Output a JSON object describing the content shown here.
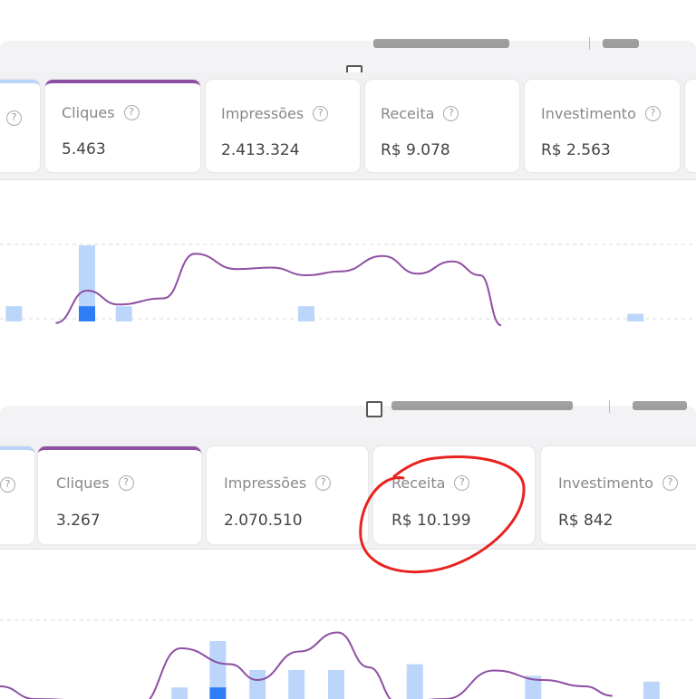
{
  "panels": [
    {
      "metrics": [
        {
          "label": "",
          "value": "",
          "state": "prev-selected"
        },
        {
          "label": "Cliques",
          "value": "5.463",
          "state": "selected"
        },
        {
          "label": "Impressões",
          "value": "2.413.324",
          "state": ""
        },
        {
          "label": "Receita",
          "value": "R$ 9.078",
          "state": ""
        },
        {
          "label": "Investimento",
          "value": "R$ 2.563",
          "state": ""
        }
      ],
      "help_icon": "?",
      "chart_data": {
        "type": "bar",
        "note_series": [
          "bars",
          "line"
        ],
        "bars": [
          {
            "x": 0.02,
            "light": 0.2,
            "dark": 0
          },
          {
            "x": 0.125,
            "light": 1.0,
            "dark": 0.2
          },
          {
            "x": 0.178,
            "light": 0.2,
            "dark": 0
          },
          {
            "x": 0.44,
            "light": 0.2,
            "dark": 0
          },
          {
            "x": 0.913,
            "light": 0.1,
            "dark": 0
          }
        ],
        "line": [
          [
            0.08,
            -0.02
          ],
          [
            0.125,
            0.4
          ],
          [
            0.17,
            0.22
          ],
          [
            0.235,
            0.3
          ],
          [
            0.28,
            0.88
          ],
          [
            0.34,
            0.68
          ],
          [
            0.39,
            0.7
          ],
          [
            0.44,
            0.6
          ],
          [
            0.49,
            0.65
          ],
          [
            0.55,
            0.85
          ],
          [
            0.6,
            0.62
          ],
          [
            0.65,
            0.78
          ],
          [
            0.69,
            0.6
          ],
          [
            0.72,
            -0.05
          ]
        ],
        "colors": {
          "light_bar": "#bcd6fb",
          "dark_bar": "#2f7df6",
          "line": "#8e4fa2",
          "grid": "#d9d9d9"
        }
      }
    },
    {
      "metrics": [
        {
          "label": "",
          "value": "",
          "state": "prev-selected"
        },
        {
          "label": "Cliques",
          "value": "3.267",
          "state": "selected"
        },
        {
          "label": "Impressões",
          "value": "2.070.510",
          "state": ""
        },
        {
          "label": "Receita",
          "value": "R$ 10.199",
          "state": "circled"
        },
        {
          "label": "Investimento",
          "value": "R$ 842",
          "state": ""
        }
      ],
      "help_icon": "?",
      "chart_data": {
        "type": "bar",
        "bars": [
          {
            "x": 0.258,
            "light": 0.2,
            "dark": 0
          },
          {
            "x": 0.313,
            "light": 1.0,
            "dark": 0.2
          },
          {
            "x": 0.37,
            "light": 0.5,
            "dark": 0
          },
          {
            "x": 0.426,
            "light": 0.5,
            "dark": 0
          },
          {
            "x": 0.483,
            "light": 0.5,
            "dark": 0
          },
          {
            "x": 0.596,
            "light": 0.6,
            "dark": 0
          },
          {
            "x": 0.766,
            "light": 0.4,
            "dark": 0
          },
          {
            "x": 0.936,
            "light": 0.3,
            "dark": 0
          }
        ],
        "line": [
          [
            0.0,
            0.2
          ],
          [
            0.05,
            0.0
          ],
          [
            0.2,
            -0.1
          ],
          [
            0.26,
            0.8
          ],
          [
            0.33,
            0.55
          ],
          [
            0.37,
            0.3
          ],
          [
            0.43,
            0.75
          ],
          [
            0.485,
            1.05
          ],
          [
            0.53,
            0.5
          ],
          [
            0.57,
            -0.05
          ],
          [
            0.64,
            0.0
          ],
          [
            0.71,
            0.45
          ],
          [
            0.78,
            0.3
          ],
          [
            0.84,
            0.2
          ],
          [
            0.88,
            0.05
          ]
        ],
        "colors": {
          "light_bar": "#bcd6fb",
          "dark_bar": "#2f7df6",
          "line": "#8e4fa2",
          "grid": "#d9d9d9",
          "annotation": "#e8231f"
        }
      }
    }
  ]
}
